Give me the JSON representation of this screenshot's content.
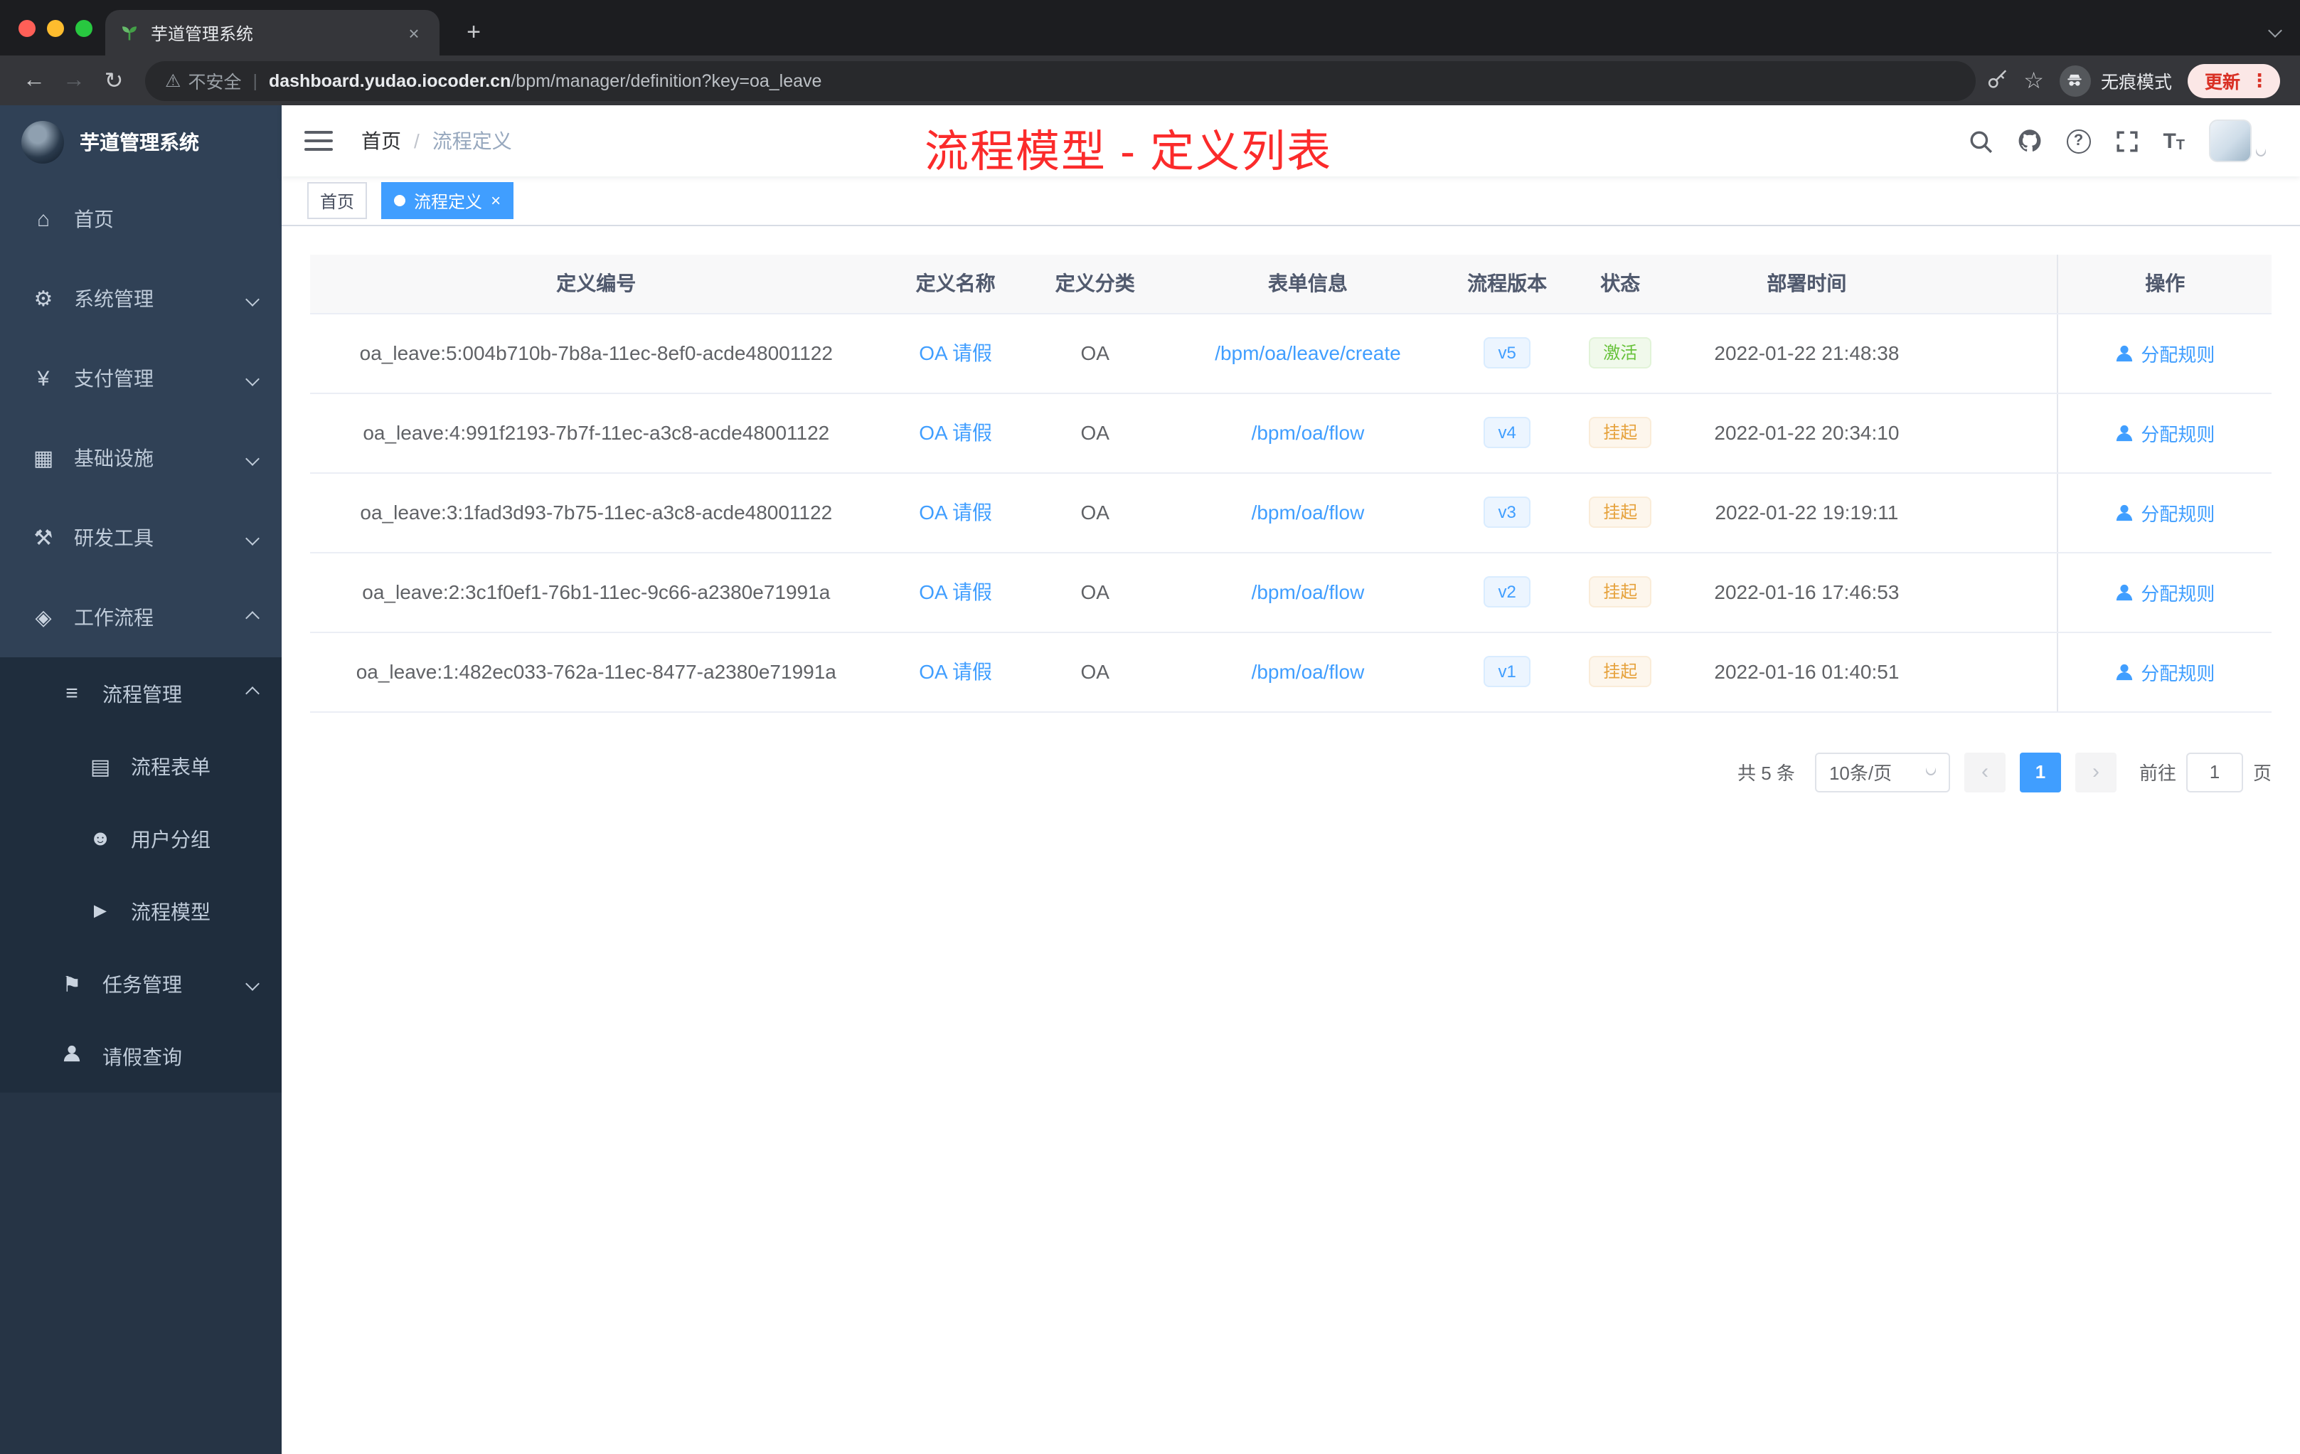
{
  "colors": {
    "accent": "#409eff",
    "success": "#67c23a",
    "warning": "#e6a23c",
    "annotation_red": "#fb2b2b",
    "sidebar_bg": "#304156"
  },
  "icons": {
    "back": "←",
    "forward": "→",
    "reload": "↻",
    "warning": "⚠",
    "divider": "|",
    "star": "☆",
    "menu": "⋮",
    "new_tab": "+",
    "close": "×",
    "breadcrumb_sep": "/",
    "home": "⌂",
    "gear": "⚙",
    "yen": "¥",
    "infra": "▦",
    "tools": "⚒",
    "workflow": "◈",
    "process_list": "≡",
    "form_doc": "▤",
    "users": "☻",
    "model_send": "►",
    "tasks": "⚑",
    "prev": "‹",
    "next": "›",
    "question": "?",
    "font_big": "T",
    "font_small": "T"
  },
  "browser": {
    "tab": {
      "title": "芋道管理系统"
    },
    "toolbar": {
      "security_label": "不安全",
      "url_domain": "dashboard.yudao.iocoder.cn",
      "url_path": "/bpm/manager/definition?key=oa_leave",
      "incognito_label": "无痕模式",
      "update_label": "更新"
    }
  },
  "sidebar": {
    "logo_title": "芋道管理系统",
    "items": [
      {
        "label": "首页"
      },
      {
        "label": "系统管理"
      },
      {
        "label": "支付管理"
      },
      {
        "label": "基础设施"
      },
      {
        "label": "研发工具"
      },
      {
        "label": "工作流程"
      }
    ],
    "submenu": [
      {
        "label": "流程管理"
      },
      {
        "label": "流程表单"
      },
      {
        "label": "用户分组"
      },
      {
        "label": "流程模型"
      },
      {
        "label": "任务管理"
      },
      {
        "label": "请假查询"
      }
    ]
  },
  "header": {
    "breadcrumb_home": "首页",
    "breadcrumb_current": "流程定义",
    "annotation": "流程模型 - 定义列表"
  },
  "tags": [
    {
      "label": "首页"
    },
    {
      "label": "流程定义"
    }
  ],
  "table": {
    "columns": [
      "定义编号",
      "定义名称",
      "定义分类",
      "表单信息",
      "流程版本",
      "状态",
      "部署时间",
      "操作"
    ],
    "rows": [
      {
        "id": "oa_leave:5:004b710b-7b8a-11ec-8ef0-acde48001122",
        "name": "OA 请假",
        "category": "OA",
        "form": "/bpm/oa/leave/create",
        "version": "v5",
        "status": "激活",
        "status_type": "success",
        "time": "2022-01-22 21:48:38",
        "action": "分配规则"
      },
      {
        "id": "oa_leave:4:991f2193-7b7f-11ec-a3c8-acde48001122",
        "name": "OA 请假",
        "category": "OA",
        "form": "/bpm/oa/flow",
        "version": "v4",
        "status": "挂起",
        "status_type": "warning",
        "time": "2022-01-22 20:34:10",
        "action": "分配规则"
      },
      {
        "id": "oa_leave:3:1fad3d93-7b75-11ec-a3c8-acde48001122",
        "name": "OA 请假",
        "category": "OA",
        "form": "/bpm/oa/flow",
        "version": "v3",
        "status": "挂起",
        "status_type": "warning",
        "time": "2022-01-22 19:19:11",
        "action": "分配规则"
      },
      {
        "id": "oa_leave:2:3c1f0ef1-76b1-11ec-9c66-a2380e71991a",
        "name": "OA 请假",
        "category": "OA",
        "form": "/bpm/oa/flow",
        "version": "v2",
        "status": "挂起",
        "status_type": "warning",
        "time": "2022-01-16 17:46:53",
        "action": "分配规则"
      },
      {
        "id": "oa_leave:1:482ec033-762a-11ec-8477-a2380e71991a",
        "name": "OA 请假",
        "category": "OA",
        "form": "/bpm/oa/flow",
        "version": "v1",
        "status": "挂起",
        "status_type": "warning",
        "time": "2022-01-16 01:40:51",
        "action": "分配规则"
      }
    ]
  },
  "pagination": {
    "total": "共 5 条",
    "page_size": "10条/页",
    "current_page": "1",
    "goto_label": "前往",
    "goto_value": "1",
    "goto_unit": "页"
  }
}
